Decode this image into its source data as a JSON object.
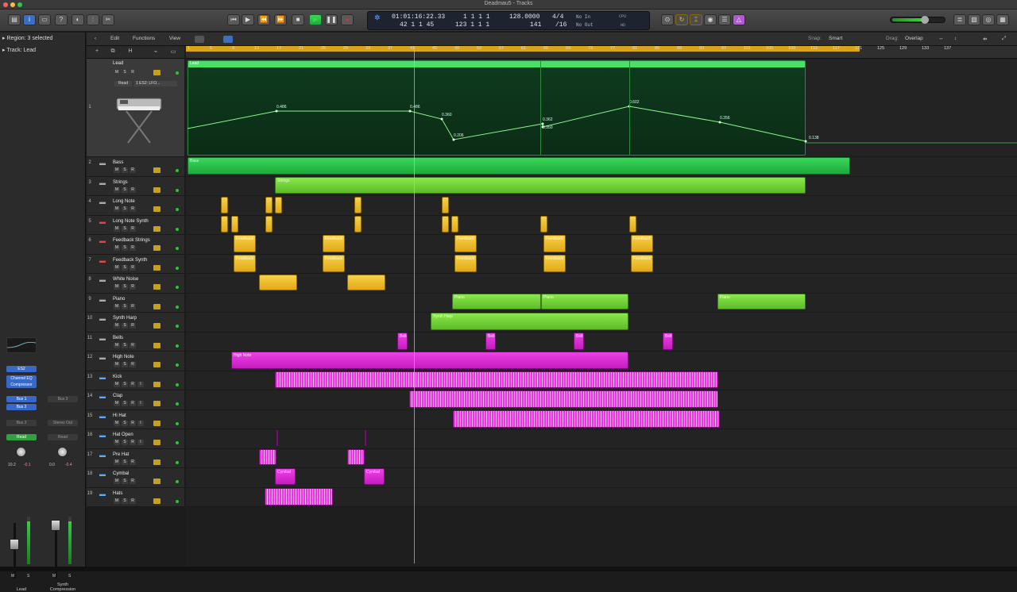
{
  "window": {
    "title": "Deadmau5 - Tracks"
  },
  "transport": {
    "position_time": "01:01:16:22.33",
    "position_bars": "42  1  1  45",
    "bar_beat": "1  1  1   1",
    "end_bars": "123  1  1   1",
    "tempo": "128.0000",
    "tempo2": "141",
    "signature": "4/4",
    "division": "/16",
    "in": "No In",
    "out": "No Out",
    "cpu_label": "CPU",
    "hd_label": "HD"
  },
  "inspector": {
    "region_label": "Region: 3 selected",
    "track_label": "Track: Lead",
    "strip1": {
      "eq": "Channel EQ",
      "comp": "Compressor",
      "bus_a": "Bus 1",
      "bus_b": "Bus 2",
      "out": "Bus 3",
      "read": "Read",
      "left_val": "10.2",
      "right_val": "-0.1",
      "m": "M",
      "s": "S",
      "name": "Lead"
    },
    "strip2": {
      "bus": "Bus 3",
      "out": "Stereo Out",
      "read": "Read",
      "left_val": "0.0",
      "right_val": "-0.4",
      "m": "M",
      "s": "S",
      "name": "Synth Compression"
    }
  },
  "menus": {
    "edit": "Edit",
    "functions": "Functions",
    "view": "View",
    "snap_label": "Snap:",
    "snap_value": "Smart",
    "drag_label": "Drag:",
    "drag_value": "Overlap"
  },
  "ruler": [
    "1",
    "5",
    "9",
    "13",
    "17",
    "21",
    "25",
    "29",
    "33",
    "37",
    "41",
    "45",
    "49",
    "53",
    "57",
    "61",
    "65",
    "69",
    "73",
    "77",
    "81",
    "85",
    "89",
    "93",
    "97",
    "101",
    "105",
    "109",
    "113",
    "117",
    "121",
    "125",
    "129",
    "133",
    "137"
  ],
  "tracks": [
    {
      "num": "1",
      "name": "Lead"
    },
    {
      "num": "2",
      "name": "Bass"
    },
    {
      "num": "3",
      "name": "Strings"
    },
    {
      "num": "4",
      "name": "Long Note"
    },
    {
      "num": "5",
      "name": "Long Note Synth"
    },
    {
      "num": "6",
      "name": "Feedback Strings"
    },
    {
      "num": "7",
      "name": "Feedback Synth"
    },
    {
      "num": "8",
      "name": "White Noise"
    },
    {
      "num": "9",
      "name": "Piano"
    },
    {
      "num": "10",
      "name": "Synth Harp"
    },
    {
      "num": "11",
      "name": "Bells"
    },
    {
      "num": "12",
      "name": "High Note"
    },
    {
      "num": "13",
      "name": "Kick"
    },
    {
      "num": "14",
      "name": "Clap"
    },
    {
      "num": "15",
      "name": "Hi Hat"
    },
    {
      "num": "16",
      "name": "Hat Open"
    },
    {
      "num": "17",
      "name": "Pre Hat"
    },
    {
      "num": "18",
      "name": "Cymbal"
    },
    {
      "num": "19",
      "name": "Hats"
    }
  ],
  "track_buttons": {
    "m": "M",
    "s": "S",
    "r": "R",
    "i": "I"
  },
  "lead_read": "Read",
  "lead_plugin": "1 ES2: LFO...",
  "regions": {
    "lead": "Lead",
    "bass": "Bass",
    "strings": "Strings",
    "feedback": "Feedback",
    "piano": "Piano",
    "harp": "Synth Harp",
    "bells": "Bells",
    "high": "High Note",
    "cymbal": "Cymbal"
  },
  "automation_values": [
    "0.486",
    "0.486",
    "0.360",
    "0.206",
    "0.362",
    "0.350",
    "0.602",
    "0.356",
    "0.138"
  ],
  "colors": {
    "green": "#2fd050",
    "lime": "#7ed83c",
    "yellow": "#f0c030",
    "magenta": "#e030dc",
    "cycle": "#d8a418"
  }
}
